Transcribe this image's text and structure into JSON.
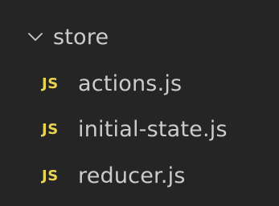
{
  "explorer": {
    "folder": {
      "name": "store",
      "expanded": true,
      "icon": "chevron-down-icon"
    },
    "files": [
      {
        "icon_label": "JS",
        "name": "actions.js",
        "icon": "js-file-icon"
      },
      {
        "icon_label": "JS",
        "name": "initial-state.js",
        "icon": "js-file-icon"
      },
      {
        "icon_label": "JS",
        "name": "reducer.js",
        "icon": "js-file-icon"
      }
    ]
  },
  "colors": {
    "background": "#252526",
    "text": "#cccccc",
    "js_icon": "#e8d44d"
  }
}
